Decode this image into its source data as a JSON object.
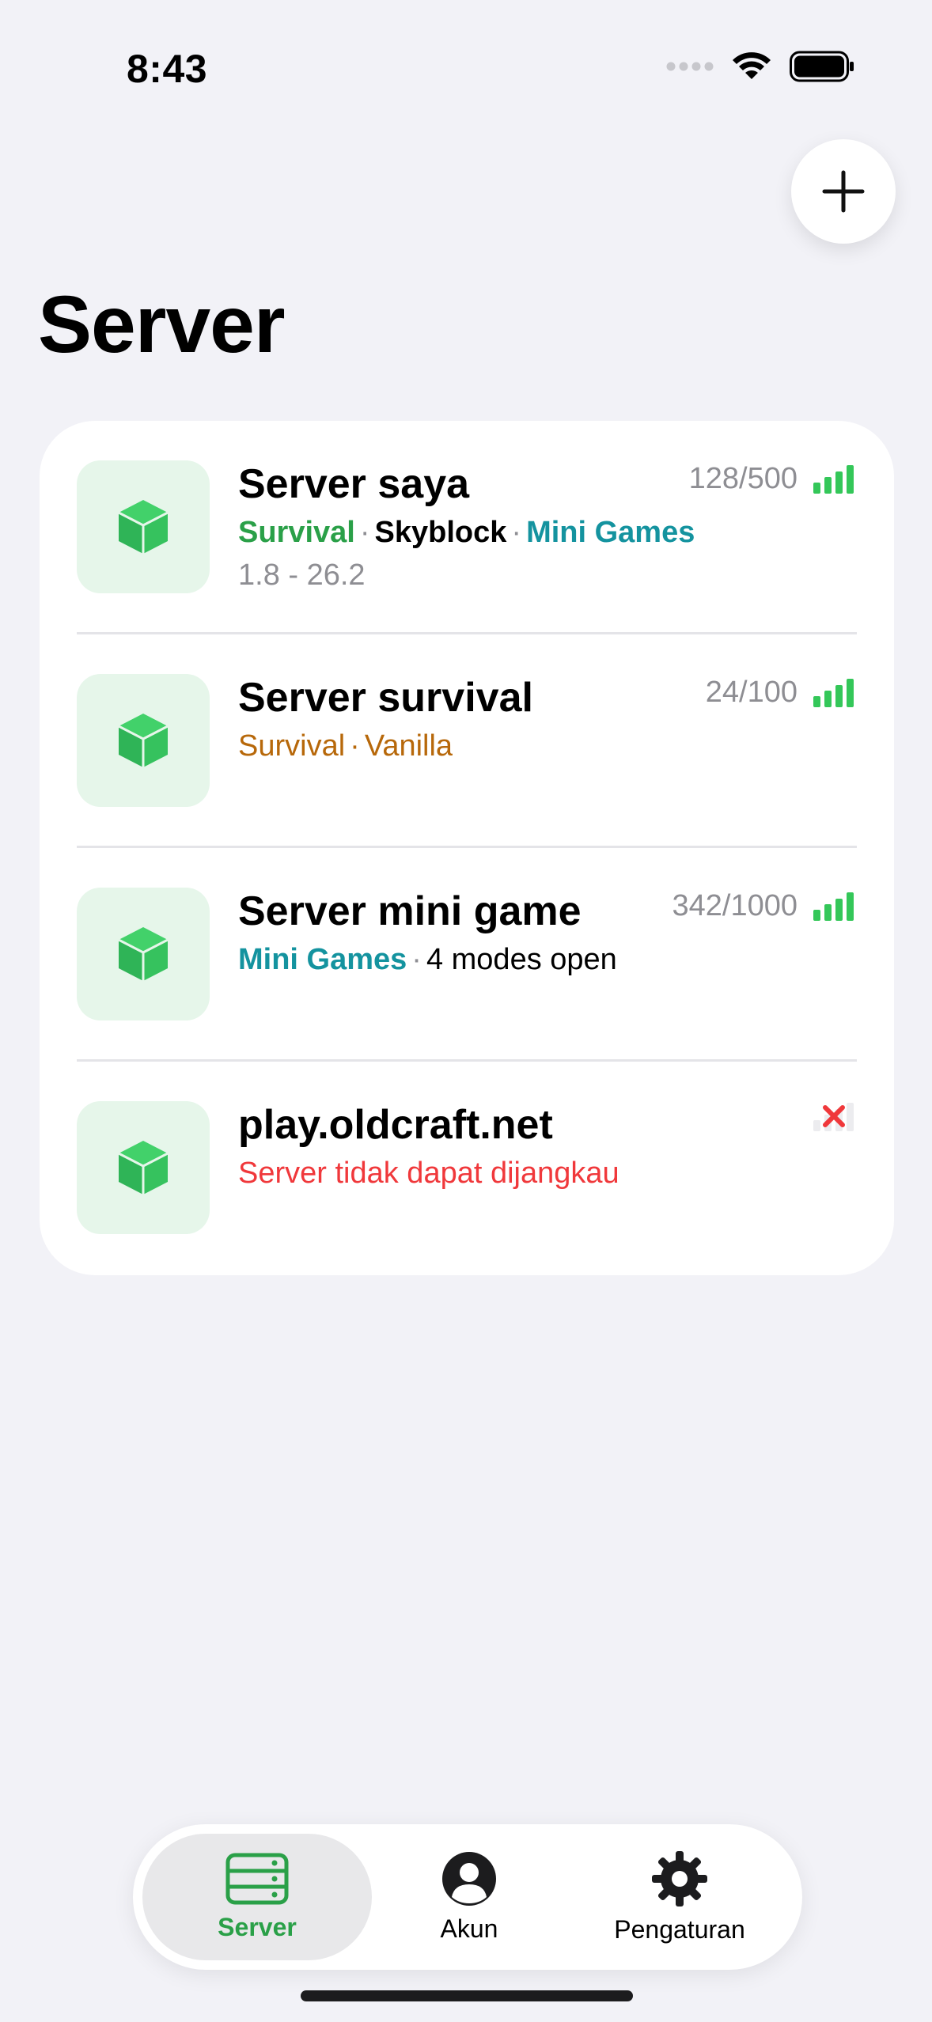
{
  "status_bar": {
    "time": "8:43",
    "icons": [
      "signal-dots-icon",
      "wifi-icon",
      "battery-icon"
    ]
  },
  "header": {
    "title": "Server",
    "add_icon": "plus-icon"
  },
  "servers": [
    {
      "name": "Server saya",
      "players": "128/500",
      "signal": "full",
      "tags": [
        {
          "text": "Survival",
          "color": "#2aa048"
        },
        {
          "text": "Skyblock",
          "color": "#000000"
        },
        {
          "text": "Mini Games",
          "color": "#14939f"
        }
      ],
      "version": "1.8 - 26.2"
    },
    {
      "name": "Server survival",
      "players": "24/100",
      "signal": "full",
      "tags": [
        {
          "text": "Survival",
          "color": "#b7680a"
        },
        {
          "text": "Vanilla",
          "color": "#b7680a"
        }
      ]
    },
    {
      "name": "Server mini game",
      "players": "342/1000",
      "signal": "full",
      "tags": [
        {
          "text": "Mini Games",
          "color": "#14939f"
        },
        {
          "text": "4 modes open",
          "color": "#000000"
        }
      ]
    },
    {
      "name": "play.oldcraft.net",
      "status": "Server tidak dapat dijangkau",
      "signal": "unreachable"
    }
  ],
  "tabbar": {
    "tabs": [
      {
        "label": "Server",
        "icon": "server-rack-icon",
        "active": true
      },
      {
        "label": "Akun",
        "icon": "person-circle-icon",
        "active": false
      },
      {
        "label": "Pengaturan",
        "icon": "gear-icon",
        "active": false
      }
    ]
  },
  "colors": {
    "accent": "#2aa048",
    "signal": "#34c759",
    "error": "#f0383b"
  }
}
